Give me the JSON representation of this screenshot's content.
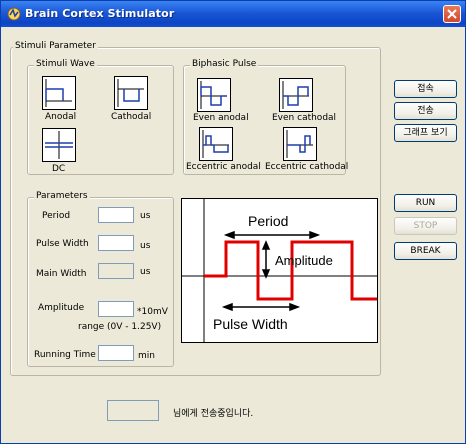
{
  "window": {
    "title": "Brain Cortex Stimulator"
  },
  "stimuli_parameter": {
    "label": "Stimuli Parameter",
    "stimuli_wave": {
      "label": "Stimuli Wave",
      "anodal": "Anodal",
      "cathodal": "Cathodal",
      "dc": "DC"
    },
    "biphasic_pulse": {
      "label": "Biphasic Pulse",
      "even_anodal": "Even anodal",
      "even_cathodal": "Even cathodal",
      "eccentric_anodal": "Eccentric anodal",
      "eccentric_cathodal": "Eccentric cathodal"
    }
  },
  "parameters": {
    "label": "Parameters",
    "period": {
      "label": "Period",
      "unit": "us",
      "value": ""
    },
    "pulse_width": {
      "label": "Pulse Width",
      "unit": "us",
      "value": ""
    },
    "main_width": {
      "label": "Main Width",
      "unit": "us",
      "value": ""
    },
    "amplitude": {
      "label": "Amplitude",
      "unit": "*10mV",
      "value": "",
      "range": "range (0V - 1.25V)"
    },
    "running_time": {
      "label": "Running Time",
      "unit": "min",
      "value": ""
    }
  },
  "graph": {
    "period": "Period",
    "amplitude": "Amplitude",
    "pulse_width": "Pulse Width",
    "wave_color": "#e00000"
  },
  "buttons": {
    "connect": "접속",
    "transmit": "전송",
    "graph_view": "그래프 보기",
    "run": "RUN",
    "stop": "STOP",
    "break": "BREAK"
  },
  "status": {
    "recipient": "",
    "message": "님에게 전송중입니다."
  }
}
